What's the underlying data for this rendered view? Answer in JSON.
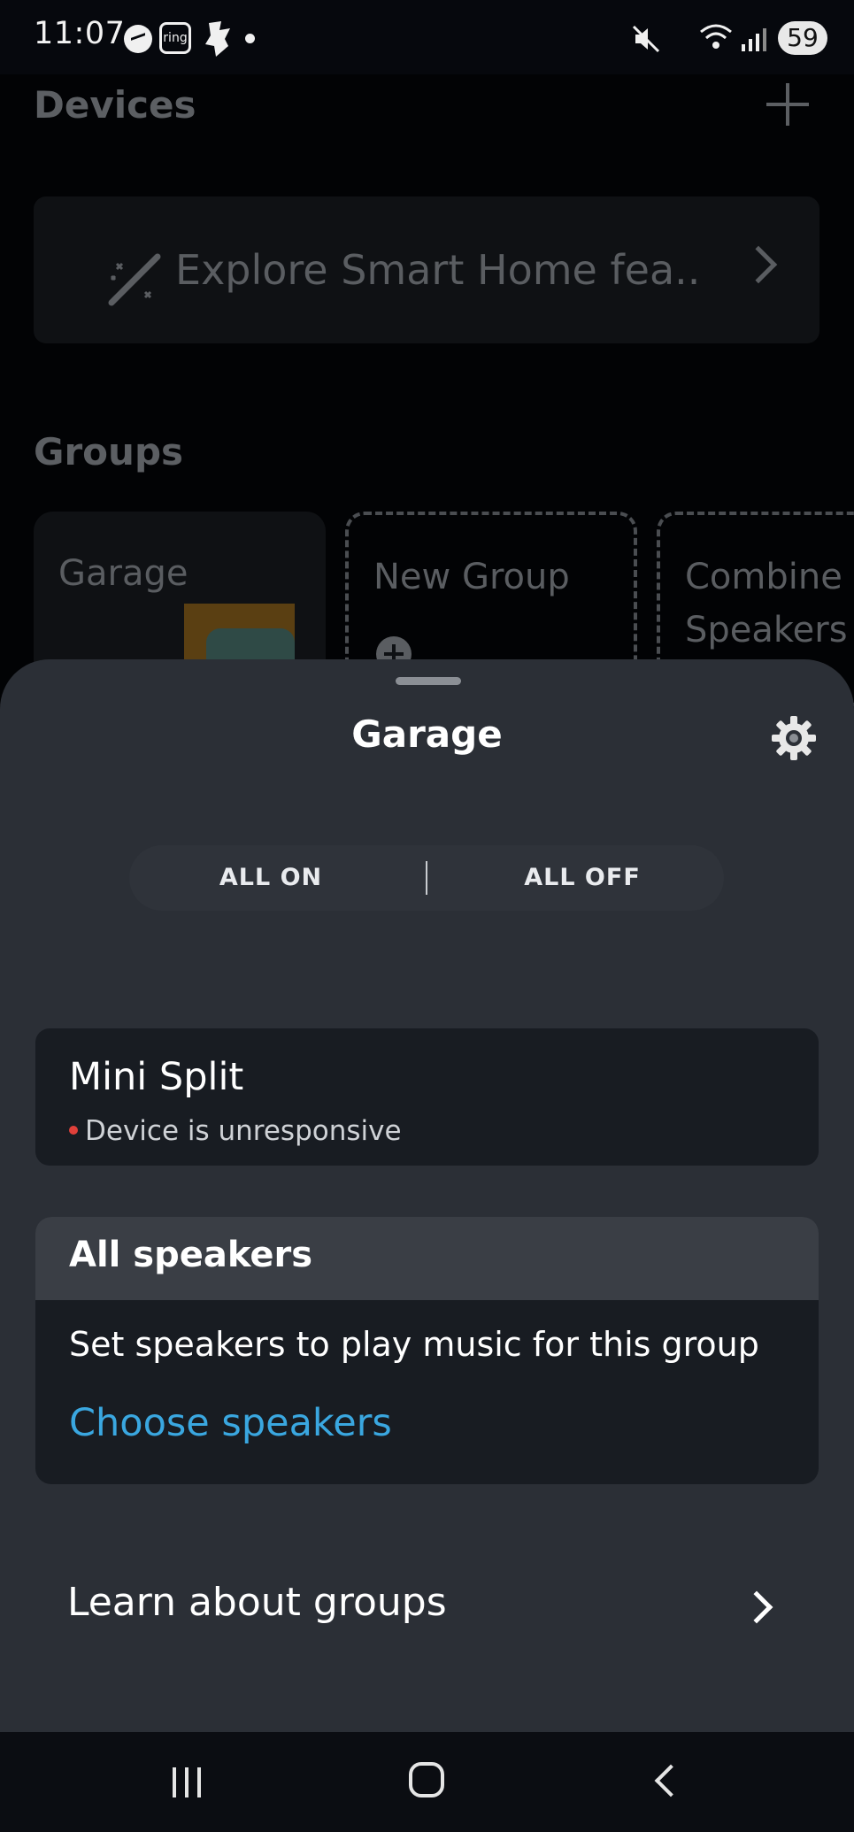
{
  "status_bar": {
    "time": "11:07",
    "battery": "59",
    "ring_label": "ring"
  },
  "background": {
    "title": "Devices",
    "explore_label": "Explore Smart Home fea..",
    "groups_title": "Groups",
    "group_cards": [
      "Garage",
      "New Group",
      "Combine Speakers"
    ]
  },
  "sheet": {
    "title": "Garage",
    "all_on": "ALL ON",
    "all_off": "ALL OFF",
    "device": {
      "name": "Mini Split",
      "status": "Device is unresponsive"
    },
    "speakers": {
      "title": "All speakers",
      "description": "Set speakers to play music for this group",
      "link": "Choose speakers"
    },
    "learn": "Learn about groups"
  },
  "colors": {
    "sheet_bg": "#2b2f36",
    "card_bg": "#181c22",
    "link": "#3aa7e0",
    "status_dot": "#e0403a"
  }
}
